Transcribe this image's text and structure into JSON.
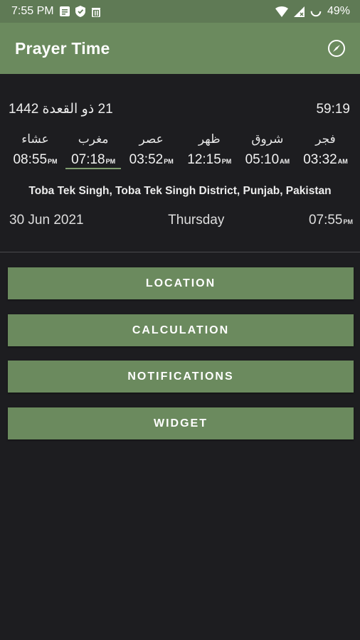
{
  "status_bar": {
    "time": "7:55 PM",
    "battery": "49%"
  },
  "app_bar": {
    "title": "Prayer Time"
  },
  "info": {
    "hijri_date": "21 ذو القعدة 1442",
    "countdown": "59:19",
    "prayers": [
      {
        "name": "فجر",
        "time": "03:32",
        "ampm": "AM"
      },
      {
        "name": "شروق",
        "time": "05:10",
        "ampm": "AM"
      },
      {
        "name": "ظهر",
        "time": "12:15",
        "ampm": "PM"
      },
      {
        "name": "عصر",
        "time": "03:52",
        "ampm": "PM"
      },
      {
        "name": "مغرب",
        "time": "07:18",
        "ampm": "PM"
      },
      {
        "name": "عشاء",
        "time": "08:55",
        "ampm": "PM"
      }
    ],
    "location": "Toba Tek Singh, Toba Tek Singh District, Punjab, Pakistan",
    "gregorian_date": "30 Jun 2021",
    "weekday": "Thursday",
    "current_time": "07:55",
    "current_ampm": "PM"
  },
  "menu": {
    "location": "LOCATION",
    "calculation": "CALCULATION",
    "notifications": "NOTIFICATIONS",
    "widget": "WIDGET"
  },
  "colors": {
    "accent": "#6b8a5e",
    "status_bar": "#5f7a55",
    "background": "#1d1d20"
  }
}
